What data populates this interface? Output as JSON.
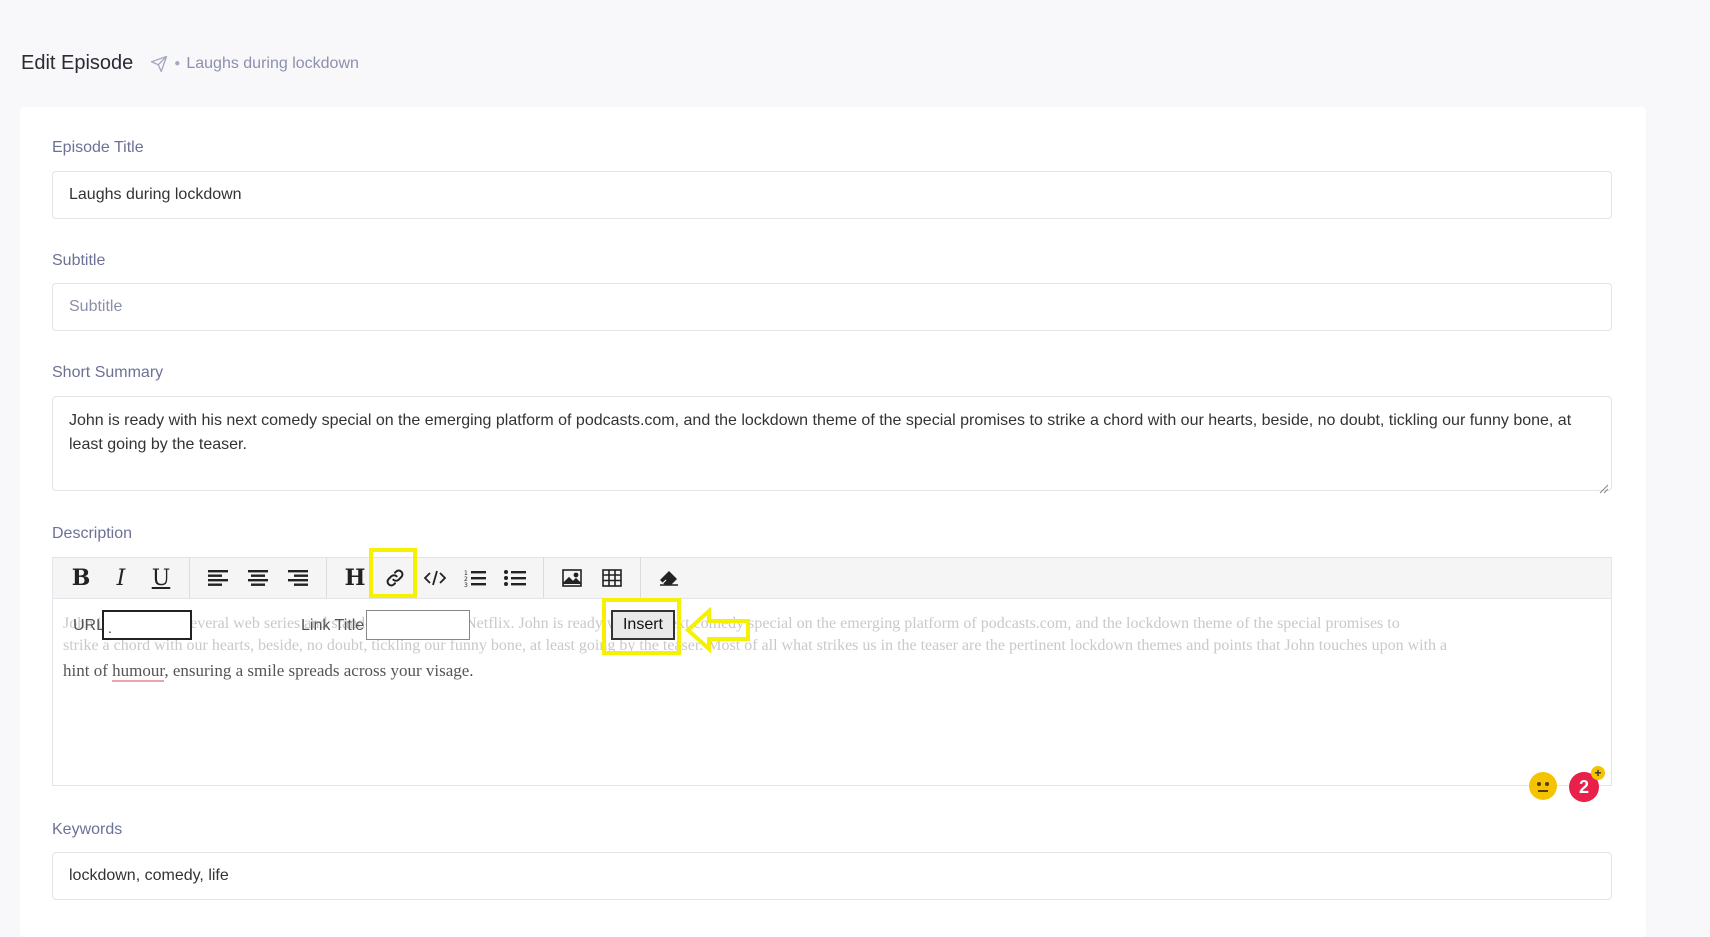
{
  "header": {
    "title": "Edit Episode",
    "breadcrumb_icon": "paper-plane-icon",
    "breadcrumb": "Laughs during lockdown"
  },
  "form": {
    "episode_title": {
      "label": "Episode Title",
      "value": "Laughs during lockdown"
    },
    "subtitle": {
      "label": "Subtitle",
      "placeholder": "Subtitle"
    },
    "summary": {
      "label": "Short Summary",
      "value": "John is ready with his next comedy special on the emerging platform of podcasts.com, and the lockdown theme of the special promises to strike a chord with our hearts, beside, no doubt, tickling our funny bone, at least going by the teaser."
    },
    "description": {
      "label": "Description",
      "toolbar": {
        "groups": [
          [
            "bold",
            "italic",
            "underline"
          ],
          [
            "align-left",
            "align-center",
            "align-right"
          ],
          [
            "heading",
            "link",
            "code",
            "ordered-list",
            "unordered-list"
          ],
          [
            "image",
            "table"
          ],
          [
            "eraser"
          ]
        ],
        "bold_glyph": "B",
        "italic_glyph": "I",
        "underline_glyph": "U",
        "heading_glyph": "H"
      },
      "link_form": {
        "url_label": "URL",
        "url_value": ".",
        "title_label": "Link Title",
        "title_value": "",
        "insert_label": "Insert"
      },
      "ghost_line_1": "John is ready with several web series and stand-up specials on Netflix. John is ready with his next comedy special on the emerging platform of podcasts.com, and the lockdown theme of the special promises to",
      "ghost_line_2": "strike a chord with our hearts, beside, no doubt, tickling our funny bone, at least going by the teaser. Most of all what strikes us in the teaser are the pertinent lockdown themes and points that John touches upon with a",
      "body_prefix": "hint of ",
      "body_spell": "humour",
      "body_suffix": ", ensuring a smile spreads across your visage.",
      "badge_count": "2",
      "badge_plus": "+"
    },
    "keywords": {
      "label": "Keywords",
      "value": "lockdown, comedy, life"
    }
  },
  "colors": {
    "highlight": "#f5f100",
    "label": "#6c7196",
    "badge": "#e8204a",
    "emoji": "#f5c400"
  }
}
